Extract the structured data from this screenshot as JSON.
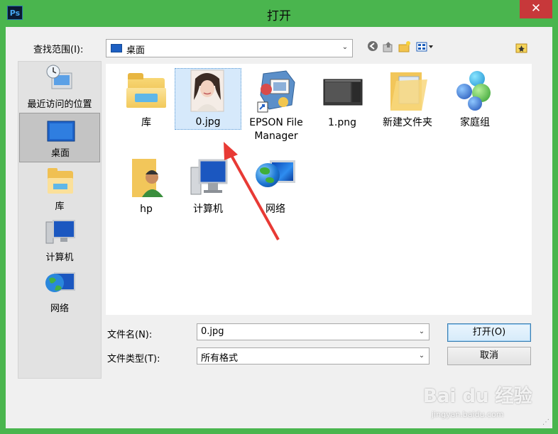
{
  "window": {
    "title": "打开",
    "app_icon_text": "Ps",
    "close_glyph": "✕"
  },
  "toolbar": {
    "lookin_label": "查找范围(I):",
    "lookin_value": "桌面",
    "icons": [
      "back-icon",
      "up-folder-icon",
      "new-folder-icon",
      "view-menu-icon",
      "desktop-favorite-icon"
    ]
  },
  "places": [
    {
      "label": "最近访问的位置",
      "icon": "recent-places-icon"
    },
    {
      "label": "桌面",
      "icon": "desktop-icon",
      "selected": true
    },
    {
      "label": "库",
      "icon": "libraries-icon"
    },
    {
      "label": "计算机",
      "icon": "computer-icon"
    },
    {
      "label": "网络",
      "icon": "network-icon"
    }
  ],
  "files": [
    {
      "label": "库",
      "icon": "libraries-folder-icon"
    },
    {
      "label": "0.jpg",
      "icon": "photo-thumbnail-icon",
      "selected": true
    },
    {
      "label": "EPSON File Manager",
      "icon": "epson-shortcut-icon"
    },
    {
      "label": "1.png",
      "icon": "screenshot-thumbnail-icon"
    },
    {
      "label": "新建文件夹",
      "icon": "folder-icon"
    },
    {
      "label": "家庭组",
      "icon": "homegroup-icon"
    },
    {
      "label": "hp",
      "icon": "user-folder-icon"
    },
    {
      "label": "计算机",
      "icon": "computer-icon"
    },
    {
      "label": "网络",
      "icon": "network-icon"
    }
  ],
  "form": {
    "filename_label": "文件名(N):",
    "filename_value": "0.jpg",
    "filetype_label": "文件类型(T):",
    "filetype_value": "所有格式",
    "open_button": "打开(O)",
    "cancel_button": "取消"
  },
  "watermark": {
    "main": "Bai du 经验",
    "sub": "jingyan.baidu.com"
  },
  "colors": {
    "frame": "#4ab54e",
    "close": "#c7383a",
    "selection": "#d6e9fb",
    "annotation_arrow": "#e83a35"
  }
}
